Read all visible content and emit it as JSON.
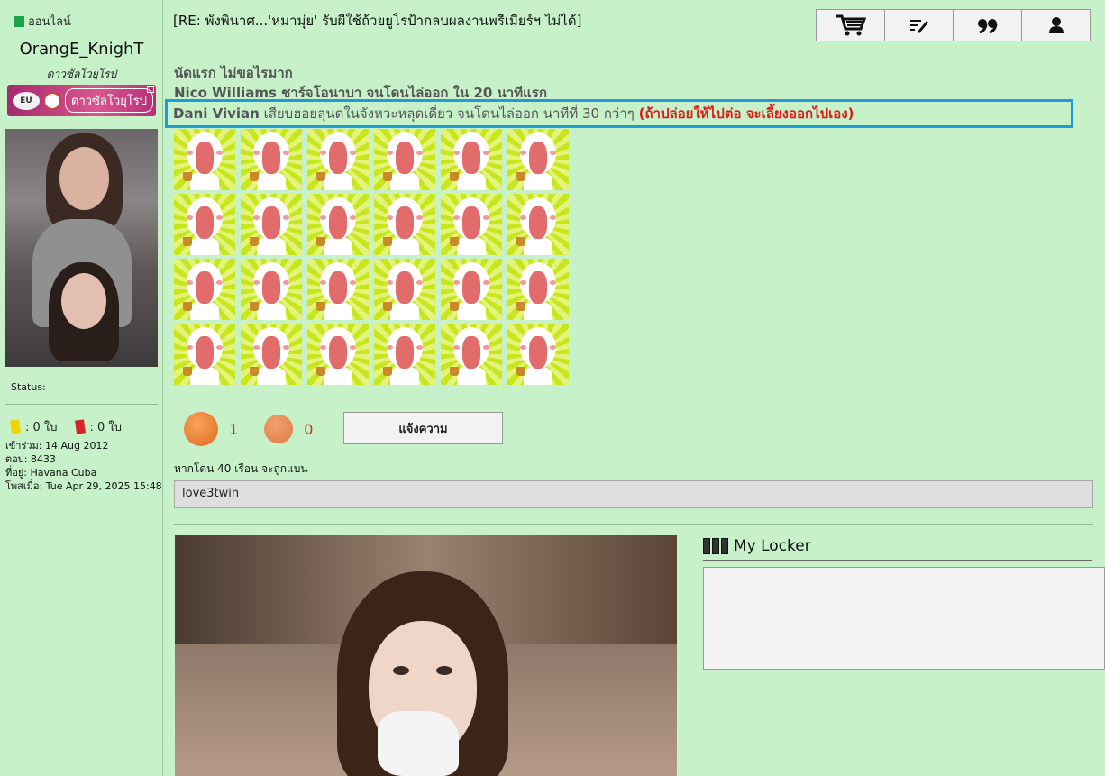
{
  "sidebar": {
    "online_label": "ออนไลน์",
    "username": "OrangE_KnighT",
    "rank": "ดาวซัลโวยุโรป",
    "badge": {
      "left": "EU",
      "text": "ดาวซัลโวยุโรป"
    },
    "status_label": "Status:",
    "yellow_cards": ": 0 ใบ",
    "red_cards": ": 0 ใบ",
    "joined": "เข้าร่วม: 14 Aug 2012",
    "replies": "ตอบ: 8433",
    "location": "ที่อยู่: Havana Cuba",
    "posted": "โพสเมื่อ: Tue Apr 29, 2025 15:48"
  },
  "post": {
    "title": "[RE: พังพินาศ...'หมามุ่ย' รับผีใช้ถ้วยยูโรป้ากลบผลงานพรีเมียร์ฯ ไม่ได้]",
    "line1": "นัดแรก ไม่ขอไรมาก",
    "line2": "Nico Williams ชาร์จโอนาบา จนโดนไล่ออก ใน 20 นาทีแรก",
    "line3_a": "Dani Vivian",
    "line3_b": " เสียบฮอยลุนดในจังหวะหลุดเดี่ยว จนโดนไล่ออก นาทีที่ 30 กว่าๆ ",
    "line3_red": "(ถ้าปล่อยให้ไปต่อ จะเลี้ยงออกไปเอง)"
  },
  "emoji_grid": {
    "rows": 4,
    "cols": 6,
    "name": "laughing-cat-emoticon"
  },
  "reactions": {
    "like_count": "1",
    "dislike_count": "0",
    "report_label": "แจ้งความ"
  },
  "warning_text": "หากโดน 40 เรื่อน จะถูกแบน",
  "signature": "love3twin",
  "locker": {
    "title": "My Locker"
  },
  "colors": {
    "background": "#c6f1c9",
    "highlight_border": "#1f9bd7",
    "accent_red": "#e01919"
  }
}
